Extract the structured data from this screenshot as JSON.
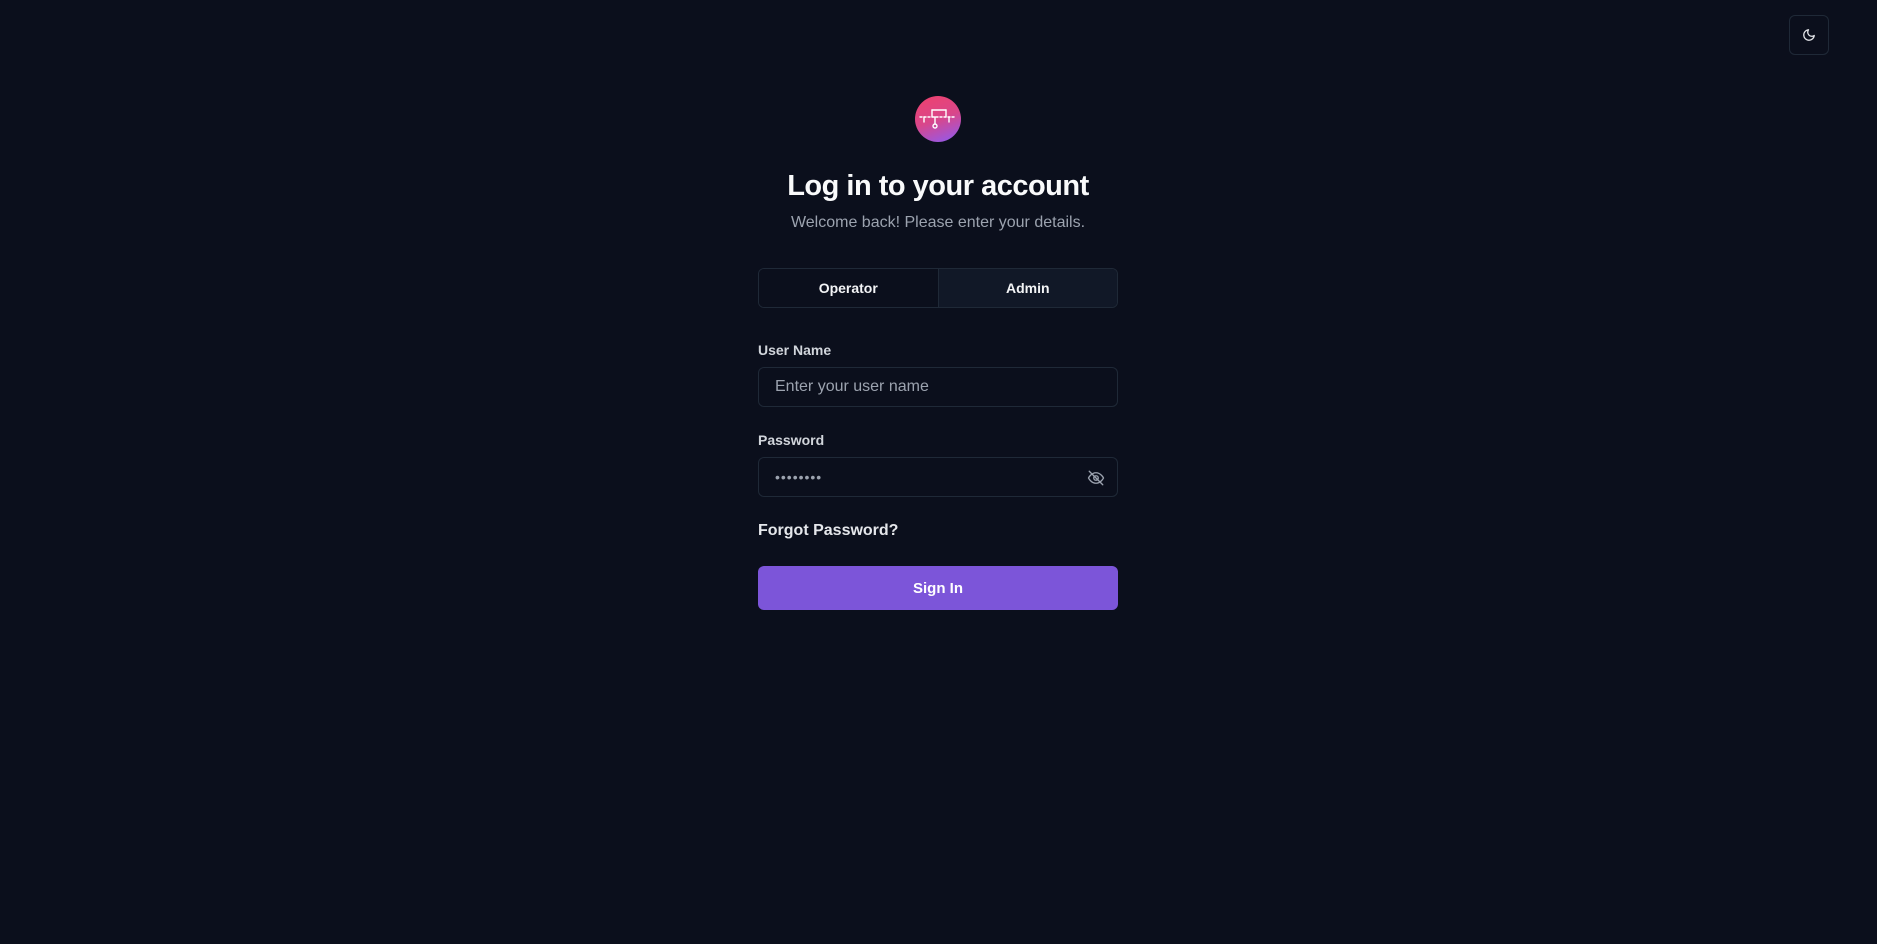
{
  "theme_toggle": {
    "icon": "moon-icon"
  },
  "brand": {
    "logo_icon": "network-logo-icon",
    "gradient": [
      "#f0416c",
      "#8b5cf6"
    ]
  },
  "login": {
    "title": "Log in to your account",
    "subtitle": "Welcome back! Please enter your details.",
    "roles": [
      {
        "label": "Operator",
        "active": false
      },
      {
        "label": "Admin",
        "active": true
      }
    ],
    "username": {
      "label": "User Name",
      "placeholder": "Enter your user name",
      "value": ""
    },
    "password": {
      "label": "Password",
      "value": "••••••••",
      "toggle_icon": "eye-off-icon"
    },
    "forgot_label": "Forgot Password?",
    "submit_label": "Sign In"
  },
  "colors": {
    "background": "#0b0f1c",
    "border": "#1f2937",
    "accent": "#7c55d9",
    "muted_text": "#9ca3af"
  }
}
